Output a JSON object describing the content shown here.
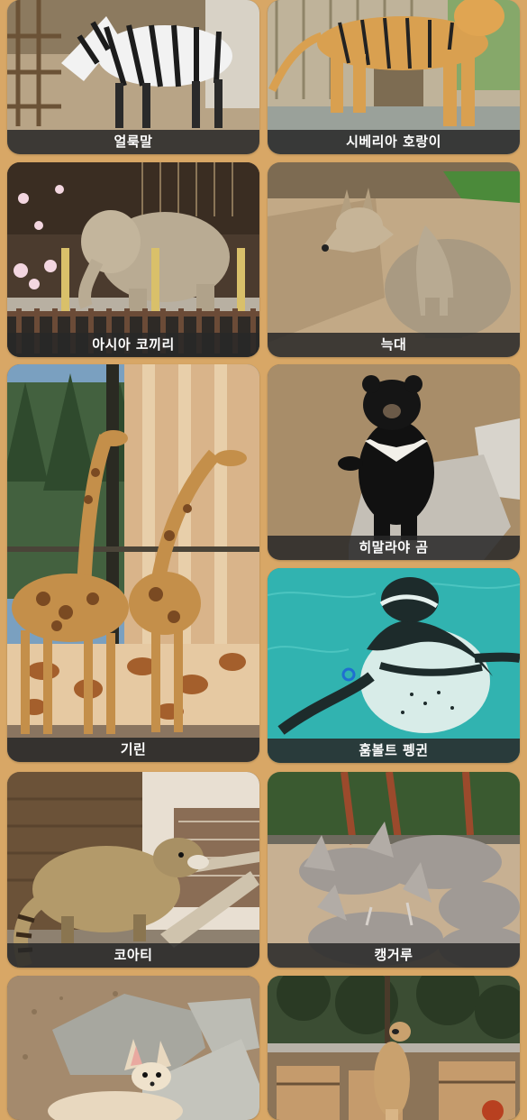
{
  "animals": [
    {
      "label": "얼룩말",
      "icon": "zebra",
      "colors": {
        "bg": "#b8a486",
        "fg": "#1c1c1c"
      }
    },
    {
      "label": "시베리아 호랑이",
      "icon": "tiger",
      "colors": {
        "bg": "#a7a08a",
        "fg": "#d9a050"
      }
    },
    {
      "label": "아시아 코끼리",
      "icon": "elephant",
      "colors": {
        "bg": "#5a4a3a",
        "fg": "#b9ab93"
      }
    },
    {
      "label": "늑대",
      "icon": "wolf",
      "colors": {
        "bg": "#b89f7c",
        "fg": "#a99a82"
      }
    },
    {
      "label": "기린",
      "icon": "giraffe",
      "colors": {
        "bg": "#55704f",
        "fg": "#c48f4a"
      }
    },
    {
      "label": "히말라야 곰",
      "icon": "bear",
      "colors": {
        "bg": "#a38a68",
        "fg": "#111111"
      }
    },
    {
      "label": "훔볼트 펭귄",
      "icon": "penguin",
      "colors": {
        "bg": "#31b3b0",
        "fg": "#1d2b2b"
      }
    },
    {
      "label": "코아티",
      "icon": "coati",
      "colors": {
        "bg": "#6b5238",
        "fg": "#b39a6a"
      }
    },
    {
      "label": "캥거루",
      "icon": "kangaroo",
      "colors": {
        "bg": "#c7b092",
        "fg": "#a09a95"
      }
    },
    {
      "label": "",
      "icon": "fennec-fox",
      "colors": {
        "bg": "#a48a6d",
        "fg": "#e8d8bf"
      }
    },
    {
      "label": "",
      "icon": "meerkat",
      "colors": {
        "bg": "#3b4d33",
        "fg": "#c9a16e"
      }
    }
  ]
}
